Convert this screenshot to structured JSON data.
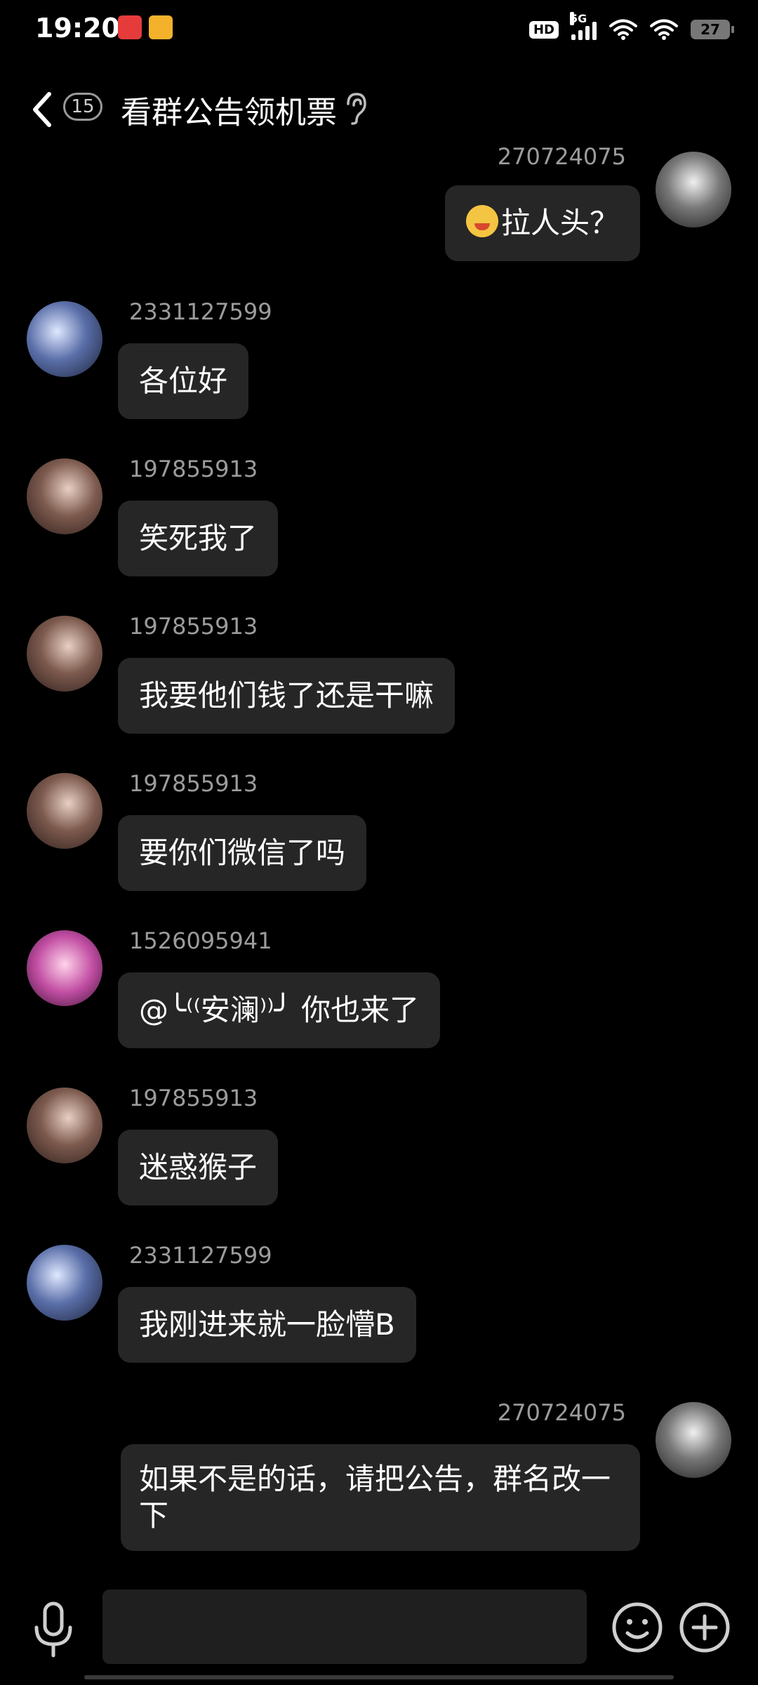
{
  "status_bar": {
    "time": "19:20",
    "hd_label": "HD",
    "network": "5G",
    "battery": "27"
  },
  "header": {
    "badge": "15",
    "title": "看群公告领机票"
  },
  "messages": [
    {
      "side": "right",
      "sender": "270724075",
      "text": "拉人头？",
      "emoji": "drooling-face-emoji"
    },
    {
      "side": "left",
      "sender": "2331127599",
      "text": "各位好"
    },
    {
      "side": "left",
      "sender": "197855913",
      "text": "笑死我了"
    },
    {
      "side": "left",
      "sender": "197855913",
      "text": "我要他们钱了还是干嘛"
    },
    {
      "side": "left",
      "sender": "197855913",
      "text": "要你们微信了吗"
    },
    {
      "side": "left",
      "sender": "1526095941",
      "text": "@╰⁽⁽安澜⁾⁾╯ 你也来了"
    },
    {
      "side": "left",
      "sender": "197855913",
      "text": "迷惑猴子"
    },
    {
      "side": "left",
      "sender": "2331127599",
      "text": "我刚进来就一脸懵B"
    },
    {
      "side": "right",
      "sender": "270724075",
      "text": "如果不是的话，请把公告，群名改一下"
    }
  ],
  "input_bar": {
    "icons": [
      "microphone-icon",
      "emoji-icon",
      "plus-icon"
    ]
  }
}
